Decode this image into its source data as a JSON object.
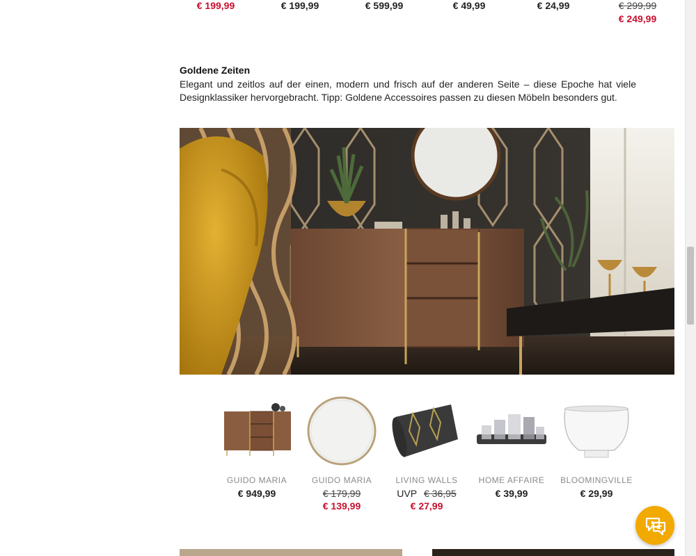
{
  "top_prices": [
    {
      "lines": [
        {
          "text": "€ 199,99",
          "style": "red"
        }
      ]
    },
    {
      "lines": [
        {
          "text": "€ 199,99",
          "style": "normal"
        }
      ]
    },
    {
      "lines": [
        {
          "text": "€ 599,99",
          "style": "normal"
        }
      ]
    },
    {
      "lines": [
        {
          "text": "€ 49,99",
          "style": "normal"
        }
      ]
    },
    {
      "lines": [
        {
          "text": "€ 24,99",
          "style": "normal"
        }
      ]
    },
    {
      "lines": [
        {
          "text": "€ 299,99",
          "style": "strike"
        },
        {
          "text": "€ 249,99",
          "style": "red"
        }
      ]
    }
  ],
  "section": {
    "title": "Goldene Zeiten",
    "text": "Elegant und zeitlos auf der einen, modern und frisch auf der anderen Seite – diese Epoche hat viele Designklassiker hervorgebracht. Tipp: Goldene Accessoires passen zu diesen Möbeln besonders gut."
  },
  "products": [
    {
      "brand": "GUIDO MARIA",
      "price": "€ 949,99",
      "icon": "sideboard-icon"
    },
    {
      "brand": "GUIDO MARIA",
      "old_price": "€ 179,99",
      "sale_price": "€ 139,99",
      "icon": "round-mirror-icon"
    },
    {
      "brand": "LIVING WALLS",
      "uvp_label": "UVP",
      "old_price": "€ 36,95",
      "sale_price": "€ 27,99",
      "icon": "wallpaper-roll-icon"
    },
    {
      "brand": "HOME AFFAIRE",
      "price": "€ 39,99",
      "icon": "tealight-holders-icon"
    },
    {
      "brand": "BLOOMINGVILLE",
      "price": "€ 29,99",
      "icon": "white-bowl-icon"
    }
  ],
  "colors": {
    "sale_red": "#c8102e",
    "chat_accent": "#f2a900",
    "brand_gray": "#8a8a8a"
  }
}
